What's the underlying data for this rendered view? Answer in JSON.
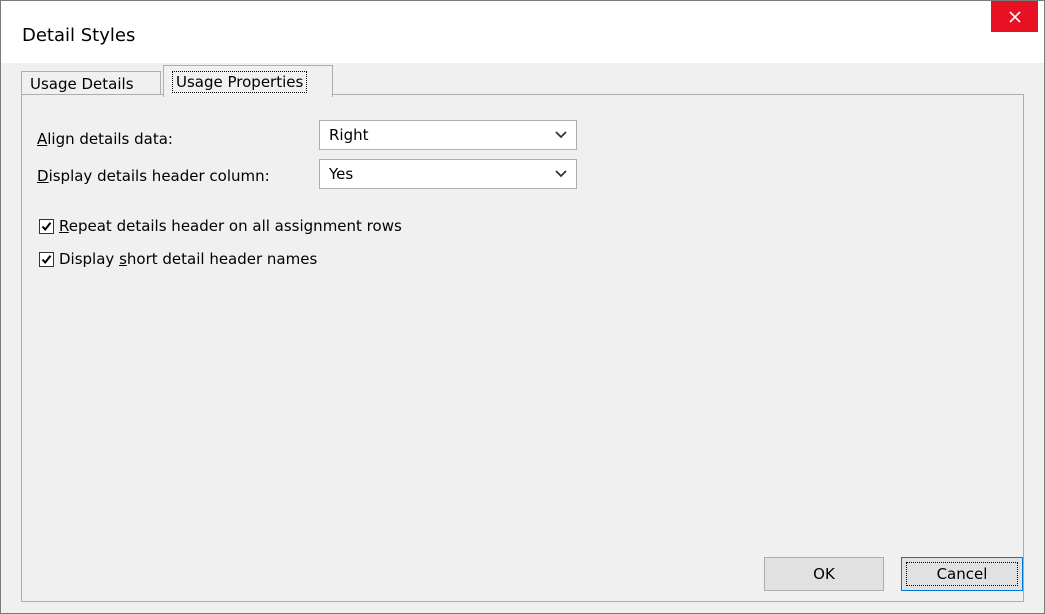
{
  "window": {
    "title": "Detail Styles"
  },
  "tabs": [
    {
      "label": "Usage Details",
      "active": false
    },
    {
      "label": "Usage Properties",
      "active": true
    }
  ],
  "form": {
    "align_details": {
      "label_mnemonic": "A",
      "label_rest": "lign details data:",
      "value": "Right"
    },
    "display_header_column": {
      "label_mnemonic": "D",
      "label_rest": "isplay details header column:",
      "value": "Yes"
    },
    "repeat_header": {
      "label_mnemonic": "R",
      "label_rest": "epeat details header on all assignment rows",
      "checked": true
    },
    "short_names": {
      "label_before": "Display ",
      "label_mnemonic": "s",
      "label_rest": "hort detail header names",
      "checked": true
    }
  },
  "buttons": {
    "ok": "OK",
    "cancel": "Cancel"
  },
  "colors": {
    "close": "#e81123",
    "focus": "#0078d7",
    "background": "#f0f0f0"
  }
}
